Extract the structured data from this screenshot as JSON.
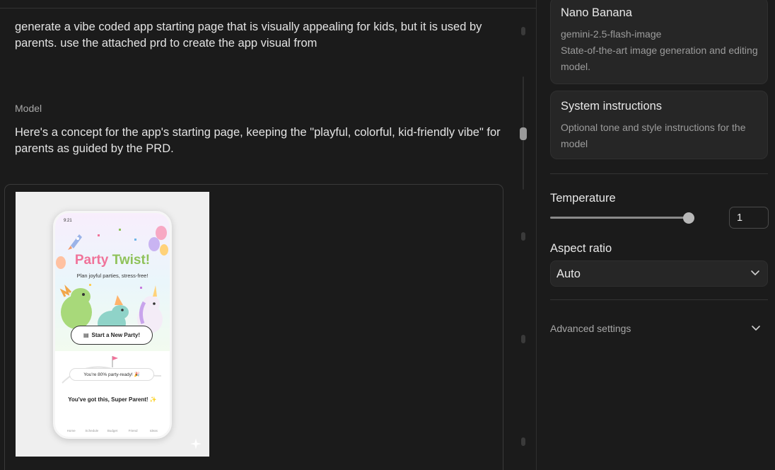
{
  "chat": {
    "user_message": "generate a vibe coded app starting page that is visually appealing for kids, but it is used by parents. use the attached prd to create the app visual from",
    "model_role_label": "Model",
    "model_message": "Here's a concept for the app's starting page, keeping the \"playful, colorful, kid-friendly vibe\" for parents as guided by the PRD.",
    "generated_image": {
      "status_time": "9:21",
      "app_title_part1": "Party",
      "app_title_part2": "Twist!",
      "tagline": "Plan joyful parties, stress-free!",
      "cta_label": "Start a New Party!",
      "progress_text": "You're 80% party-ready! 🎉",
      "cheer_text": "You've got this, Super Parent! ✨",
      "nav_items": [
        "Home",
        "Schedule",
        "Budget",
        "Friend",
        "Ideas"
      ]
    }
  },
  "model_settings": {
    "model_card": {
      "name": "Nano Banana",
      "model_id": "gemini-2.5-flash-image",
      "description": "State-of-the-art image generation and editing model."
    },
    "system_instructions": {
      "title": "System instructions",
      "placeholder": "Optional tone and style instructions for the model"
    },
    "temperature": {
      "label": "Temperature",
      "value": "1",
      "slider_fraction": 1.0
    },
    "aspect_ratio": {
      "label": "Aspect ratio",
      "selected": "Auto"
    },
    "advanced_settings_label": "Advanced settings"
  },
  "icons": {
    "aspect_ratio_chevron": "chevron-down-icon",
    "advanced_chevron": "chevron-down-icon"
  },
  "colors": {
    "background": "#1b1b1b",
    "card": "#262626",
    "muted_text": "#9c9c9c",
    "slider_handle": "#b8b8b8"
  }
}
